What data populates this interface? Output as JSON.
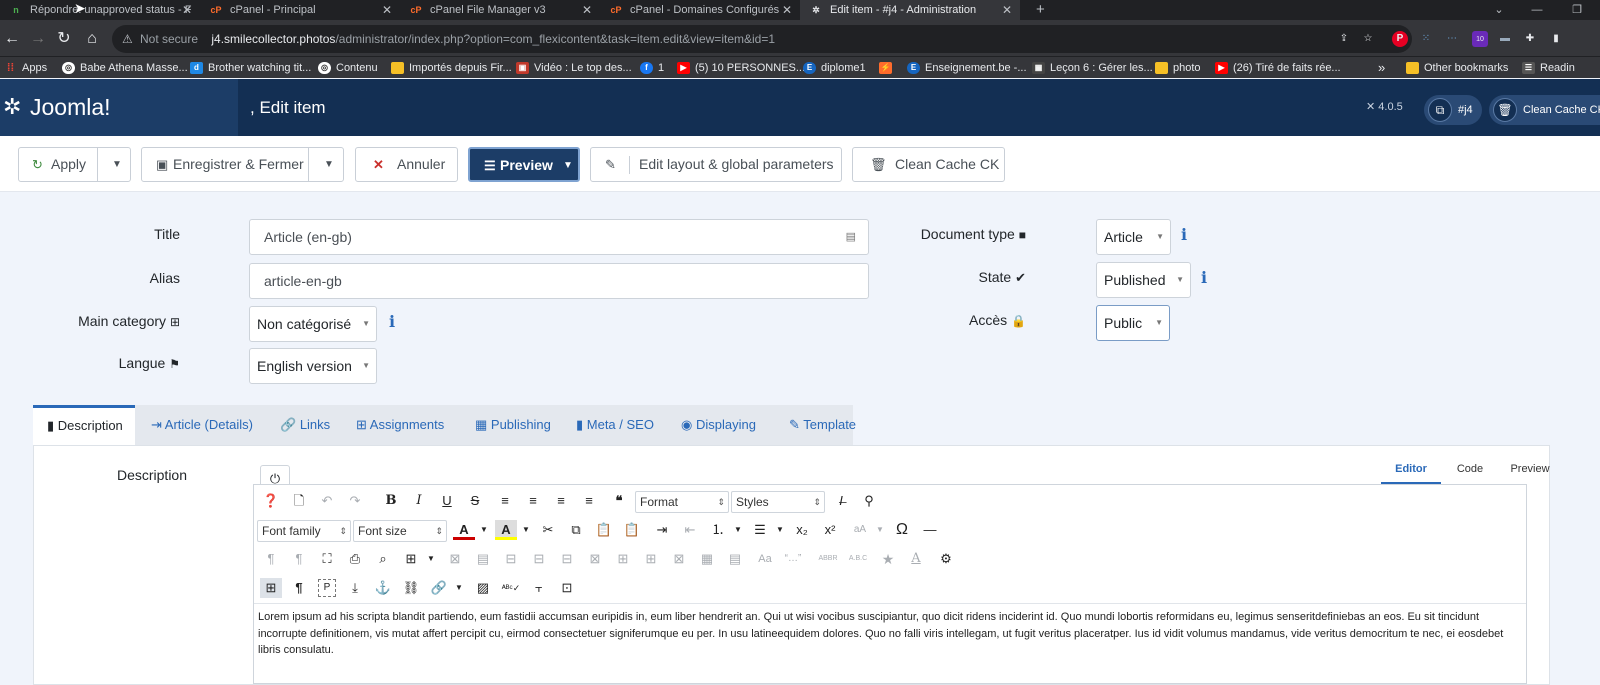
{
  "browser": {
    "tabs": [
      {
        "title": "Répondre: unapproved status - F",
        "icon": "n",
        "color": "#2e7d32"
      },
      {
        "title": "cPanel - Principal",
        "icon": "cP",
        "color": "#ff6c2c"
      },
      {
        "title": "cPanel File Manager v3",
        "icon": "cP",
        "color": "#ff6c2c"
      },
      {
        "title": "cPanel - Domaines Configurés",
        "icon": "cP",
        "color": "#ff6c2c"
      },
      {
        "title": "Edit item - #j4 - Administration",
        "icon": "joomla",
        "color": "#ffffff"
      }
    ],
    "new_tab": "+",
    "not_secure": "Not secure",
    "url_host": "j4.smilecollector.photos",
    "url_path": "/administrator/index.php?option=com_flexicontent&task=item.edit&view=item&id=1",
    "extension_badge": "10",
    "bookmarks": [
      "Apps",
      "Babe Athena Masse...",
      "Brother watching tit...",
      "Contenu",
      "Importés depuis Fir...",
      "Vidéo : Le top des...",
      "1",
      "(5) 10 PERSONNES...",
      "diplome1",
      "",
      "Enseignement.be -...",
      "Leçon 6 : Gérer les...",
      "photo",
      "(26) Tiré de faits rée..."
    ],
    "bookmarks_more": "»",
    "other_bookmarks": "Other bookmarks",
    "reading_list": "Readin"
  },
  "header": {
    "logo_text": "Joomla!",
    "page_title": ", Edit item",
    "version": "4.0.5",
    "site_button": "#j4",
    "clean_cache": "Clean Cache CK"
  },
  "toolbar": {
    "apply": "Apply",
    "save_close": "Enregistrer & Fermer",
    "cancel": "Annuler",
    "preview": "Preview",
    "edit_layout": "Edit layout & global parameters",
    "clean_cache": "Clean Cache CK"
  },
  "form": {
    "title_label": "Title",
    "title_value": "Article (en-gb)",
    "alias_label": "Alias",
    "alias_value": "article-en-gb",
    "category_label": "Main category",
    "category_value": "Non catégorisé",
    "language_label": "Langue",
    "language_value": "English version",
    "doctype_label": "Document type",
    "doctype_value": "Article",
    "state_label": "State",
    "state_value": "Published",
    "access_label": "Accès",
    "access_value": "Public"
  },
  "tabs": [
    "Description",
    "Article (Details)",
    "Links",
    "Assignments",
    "Publishing",
    "Meta / SEO",
    "Displaying",
    "Template"
  ],
  "editor": {
    "section_label": "Description",
    "mode_tabs": [
      "Editor",
      "Code",
      "Preview"
    ],
    "format_select": "Format",
    "styles_select": "Styles",
    "font_family_select": "Font family",
    "font_size_select": "Font size",
    "content": "Lorem ipsum ad his scripta blandit partiendo, eum fastidii accumsan euripidis in, eum liber hendrerit an. Qui ut wisi vocibus suscipiantur, quo dicit ridens inciderint id. Quo mundi lobortis reformidans eu, legimus senseritdefiniebas an eos. Eu sit tincidunt incorrupte definitionem, vis mutat affert percipit cu, eirmod consectetuer signiferumque eu per. In usu latineequidem dolores. Quo no falli viris intellegam, ut fugit veritus placeratper. Ius id vidit volumus mandamus, vide veritus democritum te nec, ei eosdebet libris consulatu."
  }
}
